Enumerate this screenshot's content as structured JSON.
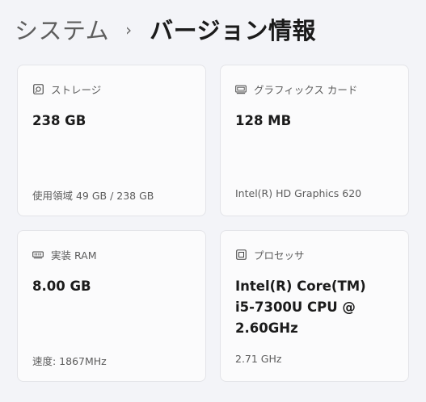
{
  "breadcrumb": {
    "parent": "システム",
    "separator": "›",
    "current": "バージョン情報"
  },
  "cards": {
    "storage": {
      "icon": "storage-icon",
      "title": "ストレージ",
      "value": "238 GB",
      "detail": "使用領域 49 GB / 238 GB"
    },
    "gpu": {
      "icon": "graphics-card-icon",
      "title": "グラフィックス カード",
      "value": "128 MB",
      "detail": "Intel(R) HD Graphics 620"
    },
    "ram": {
      "icon": "ram-icon",
      "title": "実装 RAM",
      "value": "8.00 GB",
      "detail": "速度: 1867MHz"
    },
    "cpu": {
      "icon": "processor-icon",
      "title": "プロセッサ",
      "value_lines": [
        "Intel(R) Core(TM)",
        "i5-7300U CPU @",
        "2.60GHz"
      ],
      "detail": "2.71 GHz"
    }
  }
}
